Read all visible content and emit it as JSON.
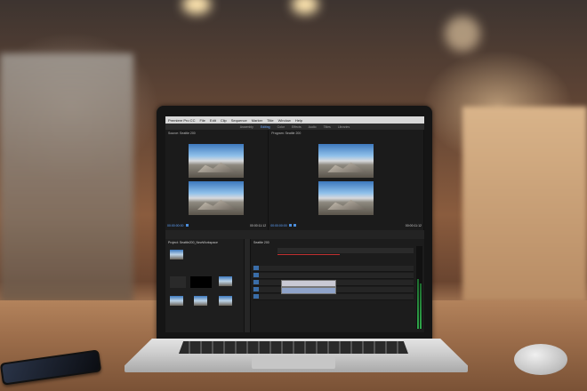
{
  "app_menu": [
    "Premiere Pro CC",
    "File",
    "Edit",
    "Clip",
    "Sequence",
    "Marker",
    "Title",
    "Window",
    "Help"
  ],
  "workspace_tabs": [
    "Assembly",
    "Editing",
    "Color",
    "Effects",
    "Audio",
    "Titles",
    "Libraries"
  ],
  "active_workspace": "Editing",
  "source_monitor": {
    "title": "Source: Seattle 200",
    "timecode_left": "00:00:00:00",
    "timecode_right": "00:00:11:12"
  },
  "program_monitor": {
    "title": "Program: Seattle 200",
    "timecode_left": "00:00:00:00",
    "timecode_right": "00:00:11:12"
  },
  "project_panel": {
    "title": "Project: Seattle200_NewWorkspace"
  },
  "timeline_panel": {
    "title": "Seattle 200"
  },
  "colors": {
    "accent": "#4b8ddb",
    "playhead": "#c03030"
  }
}
